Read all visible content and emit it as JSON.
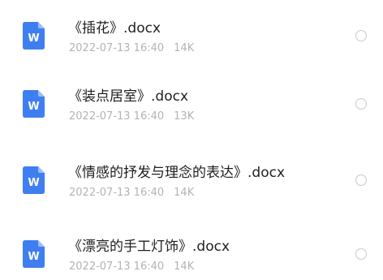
{
  "files": [
    {
      "name": "《插花》.docx",
      "date": "2022-07-13 16:40",
      "size": "14K",
      "icon": "word-doc-icon",
      "selected": false
    },
    {
      "name": "《装点居室》.docx",
      "date": "2022-07-13 16:40",
      "size": "13K",
      "icon": "word-doc-icon",
      "selected": false
    },
    {
      "name": "《情感的抒发与理念的表达》.docx",
      "date": "2022-07-13 16:40",
      "size": "14K",
      "icon": "word-doc-icon",
      "selected": false
    },
    {
      "name": "《漂亮的手工灯饰》.docx",
      "date": "2022-07-13 16:40",
      "size": "14K",
      "icon": "word-doc-icon",
      "selected": false
    }
  ],
  "icon_letter": "W",
  "colors": {
    "icon_blue": "#3f7ef0",
    "icon_fold": "#9dbdf7",
    "name_text": "#1f1f1f",
    "meta_text": "#b3b3b3",
    "radio_border": "#c9c9c9"
  }
}
